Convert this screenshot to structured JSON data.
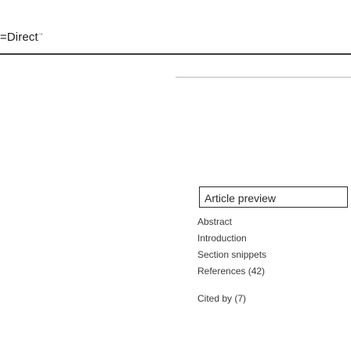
{
  "header": {
    "logo_text": "=Direct",
    "logo_trademark": "™"
  },
  "toc": {
    "preview_label": "Article preview",
    "items": [
      "Abstract",
      "Introduction",
      "Section snippets",
      "References (42)",
      "Cited by (7)"
    ]
  }
}
